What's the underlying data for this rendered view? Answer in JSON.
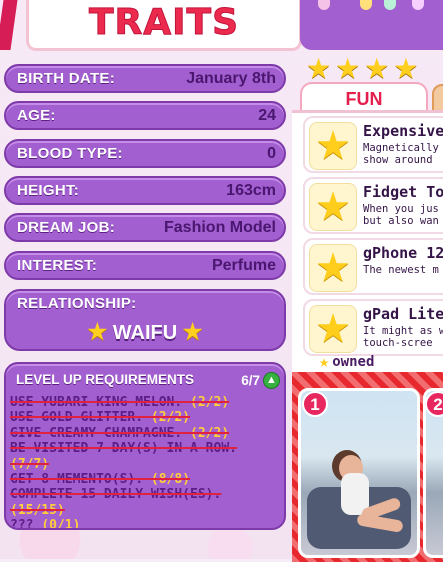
{
  "title": "TRAITS",
  "traits": [
    {
      "label": "BIRTH DATE:",
      "value": "January 8th"
    },
    {
      "label": "AGE:",
      "value": "24"
    },
    {
      "label": "BLOOD TYPE:",
      "value": "0"
    },
    {
      "label": "HEIGHT:",
      "value": "163cm"
    },
    {
      "label": "DREAM JOB:",
      "value": "Fashion Model"
    },
    {
      "label": "INTEREST:",
      "value": "Perfume"
    }
  ],
  "relationship": {
    "label": "RELATIONSHIP:",
    "value": "WAIFU"
  },
  "level_up": {
    "label": "LEVEL UP REQUIREMENTS",
    "count": "6/7",
    "requirements": [
      {
        "text": "USE YUBARI KING MELON.",
        "progress": "(2/2)"
      },
      {
        "text": "USE GOLD GLITTER.",
        "progress": "(2/2)"
      },
      {
        "text": "GIVE CREAMY CHAMPAGNE.",
        "progress": "(2/2)"
      },
      {
        "text": "BE VISITED 7 DAY(S) IN A ROW.",
        "progress": "(7/7)"
      },
      {
        "text": "GET 8 MEMENTO(S).",
        "progress": "(8/8)"
      },
      {
        "text": "COMPLETE 15 DAILY WISH(ES).",
        "progress": "(15/15)"
      },
      {
        "text": "???",
        "progress": "(0/1)"
      }
    ]
  },
  "rating_stars": 4,
  "tabs": {
    "fun": "FUN"
  },
  "shop_items": [
    {
      "name": "Expensive",
      "desc": "Magnetically\nshow around"
    },
    {
      "name": "Fidget Toy",
      "desc": "When you jus\nbut also wan"
    },
    {
      "name": "gPhone 12",
      "desc": "The newest m"
    },
    {
      "name": "gPad Lite",
      "desc": "It might as w\ntouch-scree"
    }
  ],
  "owned_label": "owned",
  "cards": [
    {
      "badge": "1"
    },
    {
      "badge": "2"
    }
  ],
  "colors": {
    "accent": "#a25fcf",
    "title": "#ec2a4e",
    "star": "#ffcf1f"
  }
}
